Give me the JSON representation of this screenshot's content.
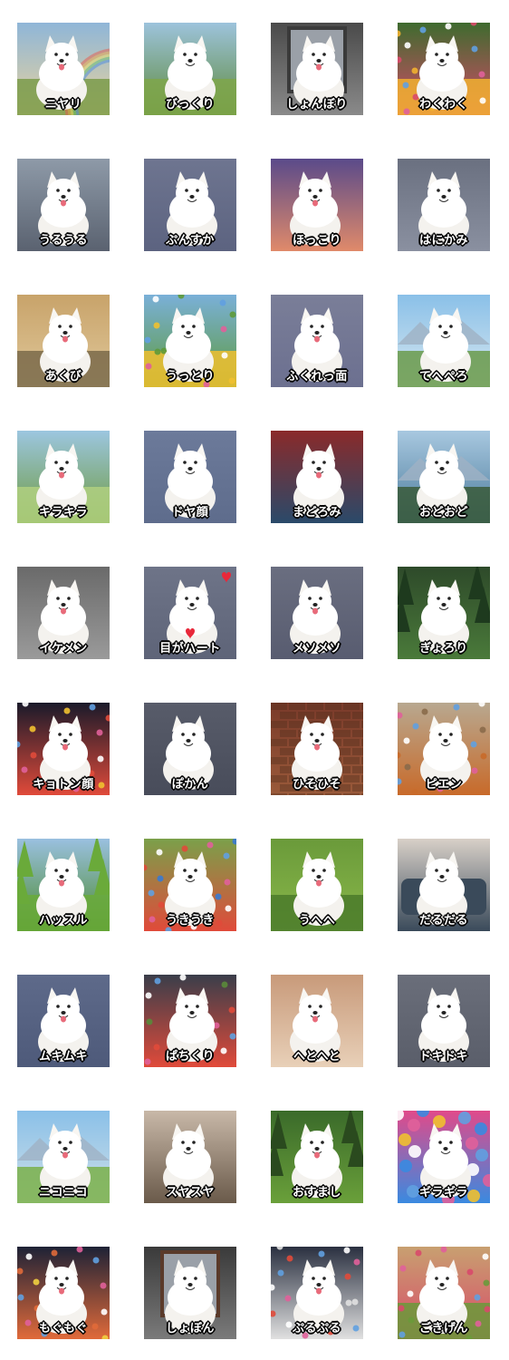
{
  "stickers": [
    {
      "caption": "ニヤリ",
      "scene": "rainbow",
      "colors": [
        "#8fb6d8",
        "#e9d39c",
        "#7a9b4a"
      ]
    },
    {
      "caption": "びっくり",
      "scene": "meadow",
      "colors": [
        "#9dc3dc",
        "#5e8a3a",
        "#7fa64a"
      ]
    },
    {
      "caption": "しょんぼり",
      "scene": "window",
      "colors": [
        "#4a4a4a",
        "#8a8a8a",
        "#3a3a3a"
      ]
    },
    {
      "caption": "わくわく",
      "scene": "flowers",
      "colors": [
        "#3e6b2e",
        "#d94a6a",
        "#f0b030"
      ]
    },
    {
      "caption": "うるうる",
      "scene": "room",
      "colors": [
        "#8e9aa8",
        "#5a6270",
        "#3c6a9a"
      ]
    },
    {
      "caption": "ぷんすか",
      "scene": "plain",
      "colors": [
        "#6e7590",
        "#5c6380",
        "#6e7590"
      ]
    },
    {
      "caption": "ほっこり",
      "scene": "sunset",
      "colors": [
        "#5a4a8a",
        "#e08a6a",
        "#2e3a4a"
      ]
    },
    {
      "caption": "はにかみ",
      "scene": "plain",
      "colors": [
        "#6a7080",
        "#8a90a0",
        "#6a7080"
      ]
    },
    {
      "caption": "あくび",
      "scene": "street",
      "colors": [
        "#c8a36a",
        "#e0c89a",
        "#7a6a4a"
      ]
    },
    {
      "caption": "うっとり",
      "scene": "flowers",
      "colors": [
        "#7ab0d8",
        "#5e9a3a",
        "#f0c030"
      ]
    },
    {
      "caption": "ふくれっ面",
      "scene": "plain",
      "colors": [
        "#7a7e98",
        "#6c7090",
        "#7a7e98"
      ]
    },
    {
      "caption": "てへぺろ",
      "scene": "mountain",
      "colors": [
        "#8ac0e8",
        "#d8e8f0",
        "#6a9a4a"
      ]
    },
    {
      "caption": "キラキラ",
      "scene": "meadow",
      "colors": [
        "#9cc6e0",
        "#6e9a3e",
        "#b0d080"
      ]
    },
    {
      "caption": "ドヤ顔",
      "scene": "plain",
      "colors": [
        "#6c7a9a",
        "#5e6c8c",
        "#6c7a9a"
      ]
    },
    {
      "caption": "まどろみ",
      "scene": "blanket",
      "colors": [
        "#8a2a2a",
        "#2a4a6a",
        "#b84a3a"
      ]
    },
    {
      "caption": "おどおど",
      "scene": "lake",
      "colors": [
        "#a8c8e0",
        "#4a7a9a",
        "#3a5a3a"
      ]
    },
    {
      "caption": "イケメン",
      "scene": "plain",
      "colors": [
        "#6a6a6a",
        "#9a9a9a",
        "#6a6a6a"
      ]
    },
    {
      "caption": "目がハート",
      "scene": "plain",
      "colors": [
        "#6e7488",
        "#5e6478",
        "#6e7488"
      ]
    },
    {
      "caption": "メソメソ",
      "scene": "plain",
      "colors": [
        "#6a6e80",
        "#585c70",
        "#6a6e80"
      ]
    },
    {
      "caption": "ぎょろり",
      "scene": "forest",
      "colors": [
        "#2e4a2a",
        "#4a7a3a",
        "#1e3a1e"
      ]
    },
    {
      "caption": "キョトン顔",
      "scene": "confetti",
      "colors": [
        "#1a1a2a",
        "#e04a3a",
        "#f0c030"
      ]
    },
    {
      "caption": "ぽかん",
      "scene": "plain",
      "colors": [
        "#585c6a",
        "#484c5a",
        "#585c6a"
      ]
    },
    {
      "caption": "ひそひそ",
      "scene": "brick",
      "colors": [
        "#7a3a2a",
        "#9a5a3a",
        "#4a2a1a"
      ]
    },
    {
      "caption": "ピエン",
      "scene": "autumn",
      "colors": [
        "#b8a890",
        "#c86a2a",
        "#8a6a4a"
      ]
    },
    {
      "caption": "ハッスル",
      "scene": "park",
      "colors": [
        "#9ac0e0",
        "#4a8a2a",
        "#6aaa3a"
      ]
    },
    {
      "caption": "うきうき",
      "scene": "toys",
      "colors": [
        "#7aa04a",
        "#e04a3a",
        "#3a7ad0"
      ]
    },
    {
      "caption": "うへへ",
      "scene": "grass",
      "colors": [
        "#6a9a3a",
        "#8ab84a",
        "#4a7a2a"
      ]
    },
    {
      "caption": "だるだる",
      "scene": "sofa",
      "colors": [
        "#d8d0c8",
        "#3a4a5a",
        "#b8b0a8"
      ]
    },
    {
      "caption": "ムキムキ",
      "scene": "plain",
      "colors": [
        "#5e6a8a",
        "#4e5a7a",
        "#5e6a8a"
      ]
    },
    {
      "caption": "ぱちくり",
      "scene": "dots",
      "colors": [
        "#3a3e4a",
        "#e04a3a",
        "#5a8a3a"
      ]
    },
    {
      "caption": "へとへと",
      "scene": "floor",
      "colors": [
        "#c89a7a",
        "#e8d0b8",
        "#a87a5a"
      ]
    },
    {
      "caption": "ドキドキ",
      "scene": "plain",
      "colors": [
        "#6a6e7a",
        "#5a5e6a",
        "#6a6e7a"
      ]
    },
    {
      "caption": "ニコニコ",
      "scene": "mountain",
      "colors": [
        "#8ac0e8",
        "#d0e0e8",
        "#7ab04a"
      ]
    },
    {
      "caption": "スヤスヤ",
      "scene": "bed",
      "colors": [
        "#c8b8a8",
        "#6a5a4a",
        "#e0d8d0"
      ]
    },
    {
      "caption": "おすまし",
      "scene": "forest",
      "colors": [
        "#3a6a2a",
        "#6aa03a",
        "#2a4a1e"
      ]
    },
    {
      "caption": "ギラギラ",
      "scene": "balloons",
      "colors": [
        "#e04a8a",
        "#3a8ae0",
        "#f0c030"
      ]
    },
    {
      "caption": "もぐもぐ",
      "scene": "confetti",
      "colors": [
        "#1e2236",
        "#e06a3a",
        "#f0d040"
      ]
    },
    {
      "caption": "しょぼん",
      "scene": "window",
      "colors": [
        "#3a3a3a",
        "#7a7a7a",
        "#5a3a2a"
      ]
    },
    {
      "caption": "ぷるぷる",
      "scene": "dots",
      "colors": [
        "#2a3040",
        "#e0e0e0",
        "#e04a3a"
      ]
    },
    {
      "caption": "ごきげん",
      "scene": "garden",
      "colors": [
        "#c8a070",
        "#d84a6a",
        "#6a9a3a"
      ]
    }
  ]
}
